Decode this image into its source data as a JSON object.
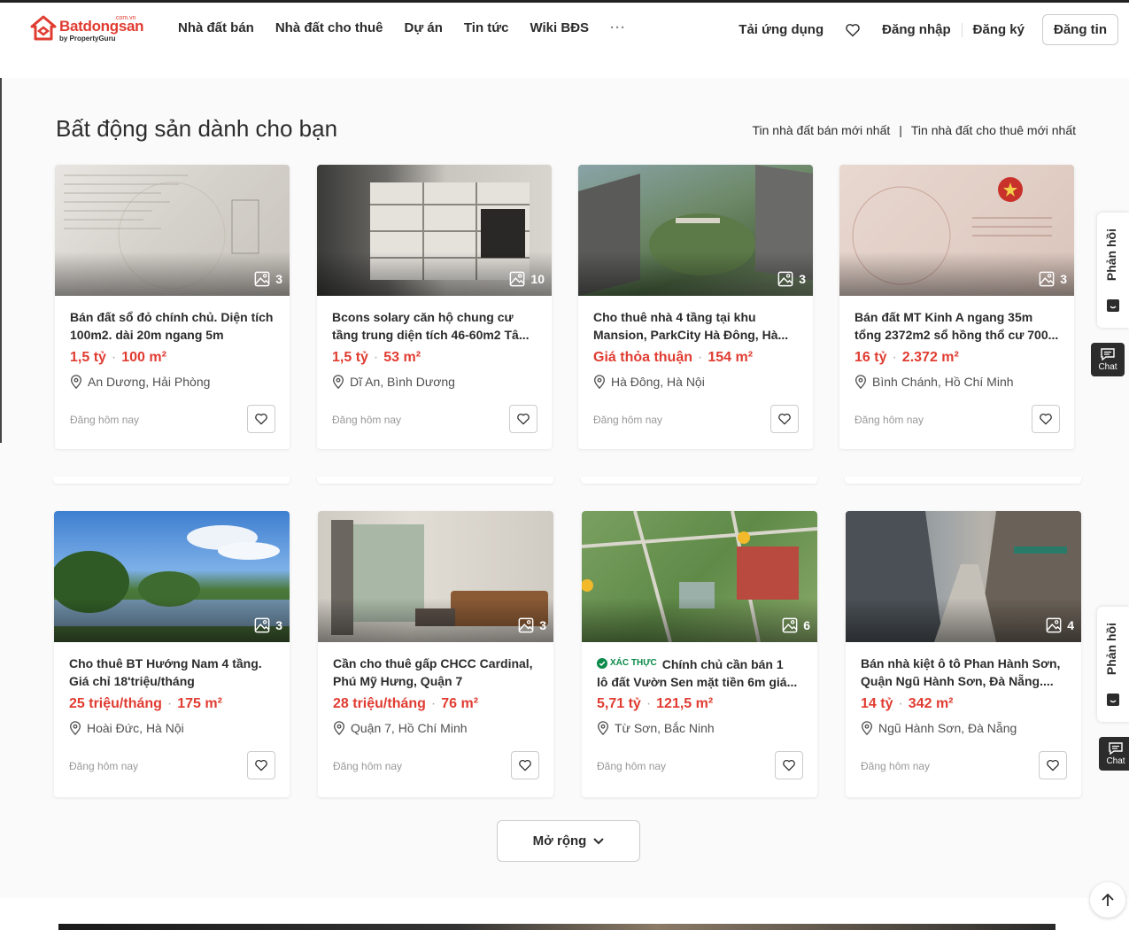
{
  "header": {
    "logo": {
      "brand": "Batdongsan",
      "tld": ".com.vn",
      "sub": "by PropertyGuru"
    },
    "nav": [
      "Nhà đất bán",
      "Nhà đất cho thuê",
      "Dự án",
      "Tin tức",
      "Wiki BĐS"
    ],
    "more": "···",
    "download_app": "Tải ứng dụng",
    "login": "Đăng nhập",
    "register": "Đăng ký",
    "post": "Đăng tin"
  },
  "section": {
    "title": "Bất động sản dành cho bạn",
    "link_sale": "Tin nhà đất bán mới nhất",
    "link_sep": "|",
    "link_rent": "Tin nhà đất cho thuê mới nhất"
  },
  "cards": [
    {
      "title1": "Bán đất sổ đỏ chính chủ. Diện tích",
      "title2": "100m2. dài 20m ngang 5m",
      "price": "1,5 tỷ",
      "area": "100 m²",
      "location": "An Dương, Hải Phòng",
      "posted": "Đăng hôm nay",
      "photos": "3",
      "verified": ""
    },
    {
      "title1": "Bcons solary căn hộ chung cư",
      "title2": "tầng trung diện tích 46-60m2 Tâ...",
      "price": "1,5 tỷ",
      "area": "53 m²",
      "location": "Dĩ An, Bình Dương",
      "posted": "Đăng hôm nay",
      "photos": "10",
      "verified": ""
    },
    {
      "title1": "Cho thuê nhà 4 tầng tại khu",
      "title2": "Mansion, ParkCity Hà Đông, Hà...",
      "price": "Giá thỏa thuận",
      "area": "154 m²",
      "location": "Hà Đông, Hà Nội",
      "posted": "Đăng hôm nay",
      "photos": "3",
      "verified": ""
    },
    {
      "title1": "Bán đất MT Kinh A ngang 35m",
      "title2": "tổng 2372m2 sổ hồng thổ cư 700...",
      "price": "16 tỷ",
      "area": "2.372 m²",
      "location": "Bình Chánh, Hồ Chí Minh",
      "posted": "Đăng hôm nay",
      "photos": "3",
      "verified": ""
    },
    {
      "title1": "Cho thuê BT Hướng Nam 4 tầng.",
      "title2": "Giá chỉ 18'triệu/tháng",
      "price": "25 triệu/tháng",
      "area": "175 m²",
      "location": "Hoài Đức, Hà Nội",
      "posted": "Đăng hôm nay",
      "photos": "3",
      "verified": ""
    },
    {
      "title1": "Cần cho thuê gấp CHCC Cardinal,",
      "title2": "Phú Mỹ Hưng, Quận 7",
      "price": "28 triệu/tháng",
      "area": "76 m²",
      "location": "Quận 7, Hồ Chí Minh",
      "posted": "Đăng hôm nay",
      "photos": "3",
      "verified": ""
    },
    {
      "title1": "Chính chủ cần bán 1",
      "title2": "lô đất Vườn Sen mặt tiền 6m giá...",
      "price": "5,71 tỷ",
      "area": "121,5 m²",
      "location": "Từ Sơn, Bắc Ninh",
      "posted": "Đăng hôm nay",
      "photos": "6",
      "verified": "XÁC THỰC"
    },
    {
      "title1": "Bán nhà kiệt ô tô Phan Hành Sơn,",
      "title2": "Quận Ngũ Hành Sơn, Đà Nẵng....",
      "price": "14 tỷ",
      "area": "342 m²",
      "location": "Ngũ Hành Sơn, Đà Nẵng",
      "posted": "Đăng hôm nay",
      "photos": "4",
      "verified": ""
    }
  ],
  "expand": "Mở rộng",
  "side": {
    "feedback": "Phản hồi",
    "chat": "Chat"
  },
  "colors": {
    "accent": "#e03c31",
    "text": "#2c2c2c",
    "verified": "#0b8a4a"
  }
}
